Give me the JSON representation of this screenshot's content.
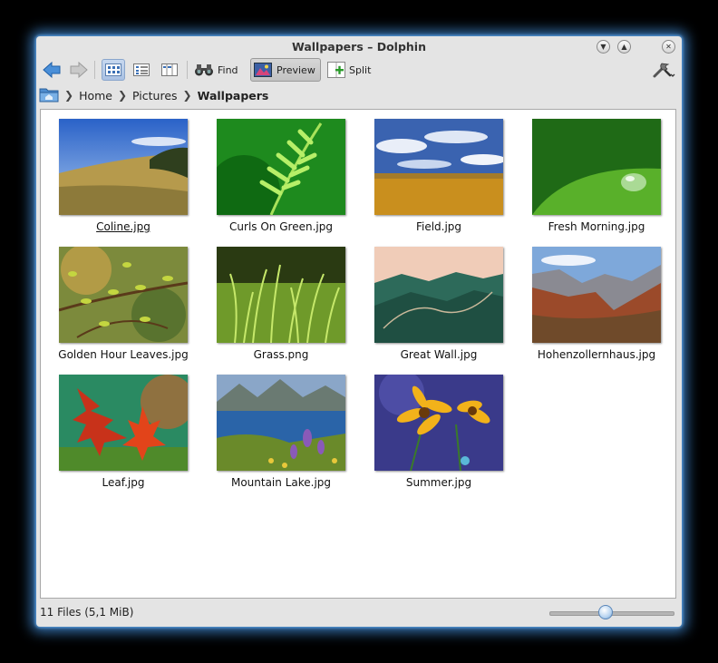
{
  "window": {
    "title": "Wallpapers – Dolphin"
  },
  "toolbar": {
    "find_label": "Find",
    "preview_label": "Preview",
    "split_label": "Split"
  },
  "breadcrumb": {
    "items": [
      "Home",
      "Pictures",
      "Wallpapers"
    ]
  },
  "files": [
    {
      "name": "Coline.jpg"
    },
    {
      "name": "Curls On Green.jpg"
    },
    {
      "name": "Field.jpg"
    },
    {
      "name": "Fresh Morning.jpg"
    },
    {
      "name": "Golden Hour Leaves.jpg"
    },
    {
      "name": "Grass.png"
    },
    {
      "name": "Great Wall.jpg"
    },
    {
      "name": "Hohenzollernhaus.jpg"
    },
    {
      "name": "Leaf.jpg"
    },
    {
      "name": "Mountain Lake.jpg"
    },
    {
      "name": "Summer.jpg"
    }
  ],
  "status": {
    "text": "11 Files (5,1 MiB)",
    "zoom_fraction": 0.45
  },
  "colors": {
    "window_glow": "#4696e6",
    "accent": "#a9c1e3"
  }
}
